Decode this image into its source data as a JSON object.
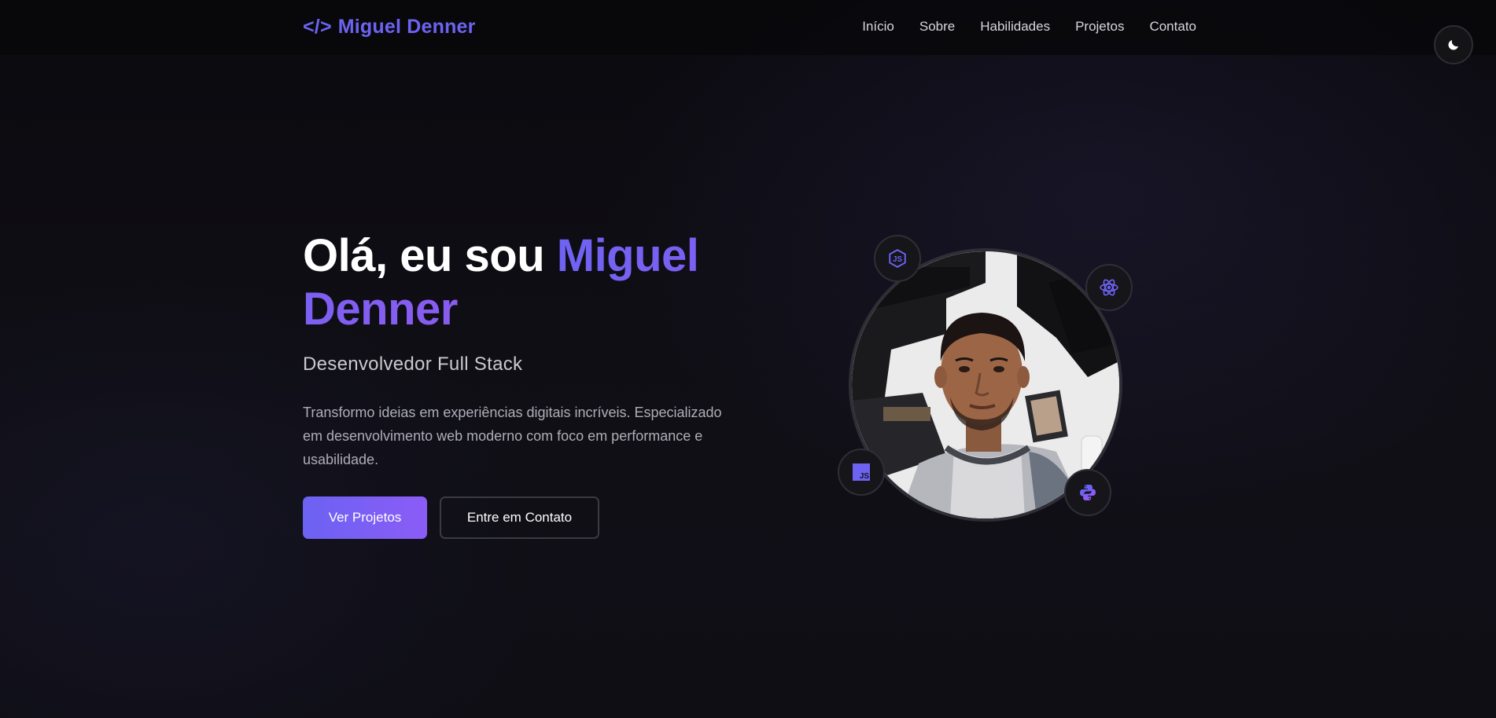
{
  "nav": {
    "logo_symbol": "</>",
    "logo_name": "Miguel Denner",
    "links": [
      "Início",
      "Sobre",
      "Habilidades",
      "Projetos",
      "Contato"
    ],
    "theme_icon": "moon-icon"
  },
  "hero": {
    "greeting": "Olá, eu sou ",
    "name": "Miguel Denner",
    "subtitle": "Desenvolvedor Full Stack",
    "description": "Transformo ideias em experiências digitais incríveis. Especializado em desenvolvimento web moderno com foco em performance e usabilidade.",
    "primary_button": "Ver Projetos",
    "secondary_button": "Entre em Contato"
  },
  "profile": {
    "badges": [
      "nodejs-icon",
      "react-icon",
      "javascript-icon",
      "python-icon"
    ]
  },
  "colors": {
    "accent": "#6d63f2",
    "accent_end": "#8b5cf6",
    "background": "#0c0b10"
  }
}
